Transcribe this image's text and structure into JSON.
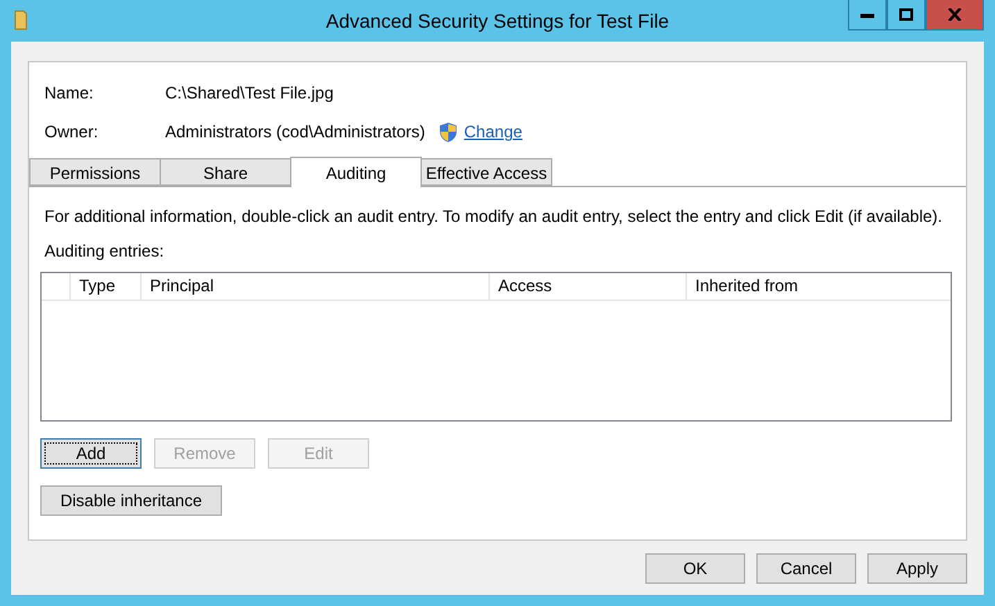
{
  "window": {
    "title": "Advanced Security Settings for Test File"
  },
  "fields": [
    {
      "label": "Name:",
      "value": "C:\\Shared\\Test File.jpg"
    },
    {
      "label": "Owner:",
      "value": "Administrators (cod\\Administrators)",
      "link": "Change"
    }
  ],
  "tabs": [
    {
      "label": "Permissions",
      "selected": false
    },
    {
      "label": "Share",
      "selected": false
    },
    {
      "label": "Auditing",
      "selected": true
    },
    {
      "label": "Effective Access",
      "selected": false
    }
  ],
  "info": "For additional information, double-click an audit entry. To modify an audit entry, select the entry and click Edit (if available).",
  "entries_label": "Auditing entries:",
  "table": {
    "columns": [
      "Type",
      "Principal",
      "Access",
      "Inherited from"
    ]
  },
  "entry_buttons": [
    {
      "label": "Add",
      "disabled": false,
      "focused": true
    },
    {
      "label": "Remove",
      "disabled": true,
      "focused": false
    },
    {
      "label": "Edit",
      "disabled": true,
      "focused": false
    }
  ],
  "inheritance_button": "Disable inheritance",
  "dialog_buttons": [
    "OK",
    "Cancel",
    "Apply"
  ]
}
